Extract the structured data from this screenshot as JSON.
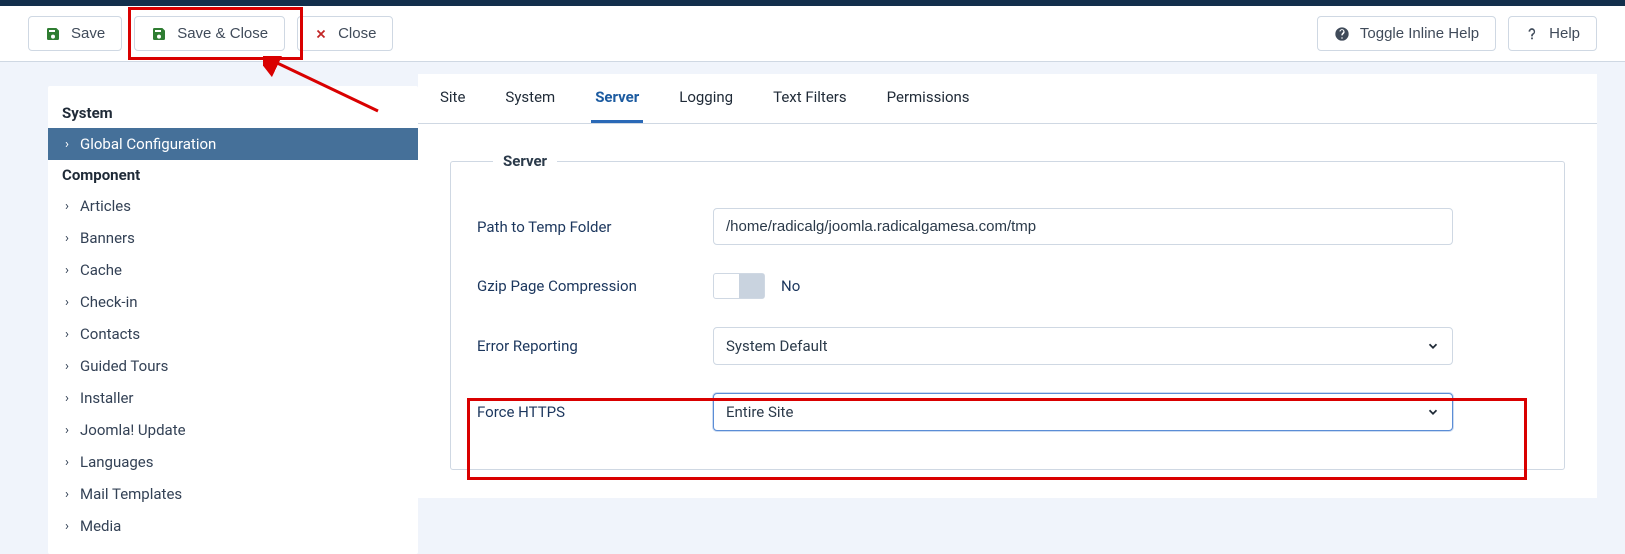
{
  "toolbar": {
    "save": "Save",
    "save_close": "Save & Close",
    "close": "Close",
    "toggle_help": "Toggle Inline Help",
    "help": "Help"
  },
  "sidebar": {
    "system_heading": "System",
    "global_config": "Global Configuration",
    "component_heading": "Component",
    "items": [
      "Articles",
      "Banners",
      "Cache",
      "Check-in",
      "Contacts",
      "Guided Tours",
      "Installer",
      "Joomla! Update",
      "Languages",
      "Mail Templates",
      "Media"
    ]
  },
  "tabs": {
    "site": "Site",
    "system": "System",
    "server": "Server",
    "logging": "Logging",
    "text_filters": "Text Filters",
    "permissions": "Permissions"
  },
  "panel": {
    "legend": "Server",
    "temp_path_label": "Path to Temp Folder",
    "temp_path_value": "/home/radicalg/joomla.radicalgamesa.com/tmp",
    "gzip_label": "Gzip Page Compression",
    "gzip_value": "No",
    "error_label": "Error Reporting",
    "error_value": "System Default",
    "https_label": "Force HTTPS",
    "https_value": "Entire Site"
  }
}
